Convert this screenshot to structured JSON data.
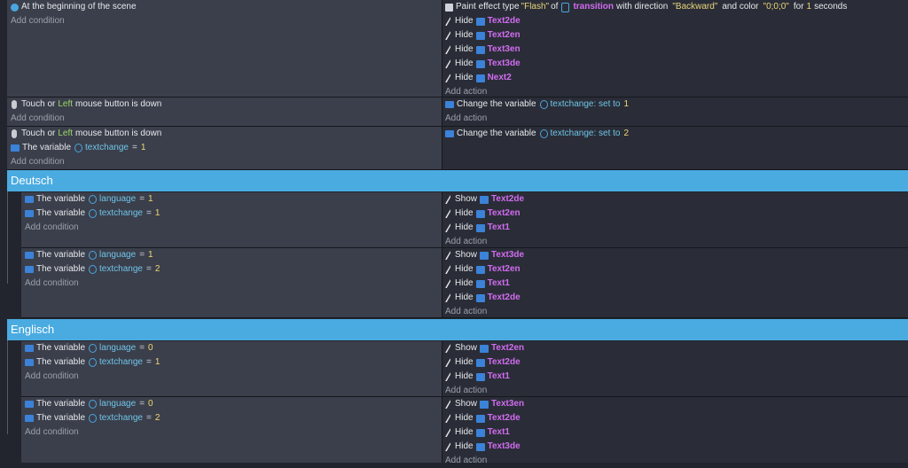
{
  "events": [
    {
      "conditions": [
        {
          "icon": "scene-icon",
          "text": "At the beginning of the scene"
        }
      ],
      "actions_effect": {
        "prefix": "Paint effect type",
        "type": "\"Flash\"",
        "of": "of",
        "object": "transition",
        "direction_label": "with direction",
        "direction": "\"Backward\"",
        "color_label": "and color",
        "color": "\"0;0;0\"",
        "for": "for",
        "duration": "1",
        "unit": "seconds"
      },
      "actions": [
        {
          "verb": "Hide",
          "object": "Text2de"
        },
        {
          "verb": "Hide",
          "object": "Text2en"
        },
        {
          "verb": "Hide",
          "object": "Text3en"
        },
        {
          "verb": "Hide",
          "object": "Text3de"
        },
        {
          "verb": "Hide",
          "object": "Next2"
        }
      ]
    },
    {
      "touch": {
        "pre": "Touch or",
        "button": "Left",
        "post": "mouse button is down"
      },
      "set_action": {
        "pre": "Change the variable",
        "variable": "textchange",
        "op": ": set to",
        "value": "1"
      }
    },
    {
      "touch": {
        "pre": "Touch or",
        "button": "Left",
        "post": "mouse button is down"
      },
      "var_condition": {
        "pre": "The variable",
        "variable": "textchange",
        "op": "=",
        "value": "1"
      },
      "set_action": {
        "pre": "Change the variable",
        "variable": "textchange",
        "op": ": set to",
        "value": "2"
      }
    }
  ],
  "groups": [
    {
      "title": "Deutsch",
      "subevents": [
        {
          "conditions": [
            {
              "pre": "The variable",
              "variable": "language",
              "op": "=",
              "value": "1"
            },
            {
              "pre": "The variable",
              "variable": "textchange",
              "op": "=",
              "value": "1"
            }
          ],
          "actions": [
            {
              "verb": "Show",
              "object": "Text2de"
            },
            {
              "verb": "Hide",
              "object": "Text2en"
            },
            {
              "verb": "Hide",
              "object": "Text1"
            }
          ]
        },
        {
          "conditions": [
            {
              "pre": "The variable",
              "variable": "language",
              "op": "=",
              "value": "1"
            },
            {
              "pre": "The variable",
              "variable": "textchange",
              "op": "=",
              "value": "2"
            }
          ],
          "actions": [
            {
              "verb": "Show",
              "object": "Text3de"
            },
            {
              "verb": "Hide",
              "object": "Text2en"
            },
            {
              "verb": "Hide",
              "object": "Text1"
            },
            {
              "verb": "Hide",
              "object": "Text2de"
            }
          ]
        }
      ]
    },
    {
      "title": "Englisch",
      "subevents": [
        {
          "conditions": [
            {
              "pre": "The variable",
              "variable": "language",
              "op": "=",
              "value": "0"
            },
            {
              "pre": "The variable",
              "variable": "textchange",
              "op": "=",
              "value": "1"
            }
          ],
          "actions": [
            {
              "verb": "Show",
              "object": "Text2en"
            },
            {
              "verb": "Hide",
              "object": "Text2de"
            },
            {
              "verb": "Hide",
              "object": "Text1"
            }
          ]
        },
        {
          "conditions": [
            {
              "pre": "The variable",
              "variable": "language",
              "op": "=",
              "value": "0"
            },
            {
              "pre": "The variable",
              "variable": "textchange",
              "op": "=",
              "value": "2"
            }
          ],
          "actions": [
            {
              "verb": "Show",
              "object": "Text3en"
            },
            {
              "verb": "Hide",
              "object": "Text2de"
            },
            {
              "verb": "Hide",
              "object": "Text1"
            },
            {
              "verb": "Hide",
              "object": "Text3de"
            }
          ]
        }
      ]
    }
  ],
  "labels": {
    "add_condition": "Add condition",
    "add_action": "Add action"
  }
}
